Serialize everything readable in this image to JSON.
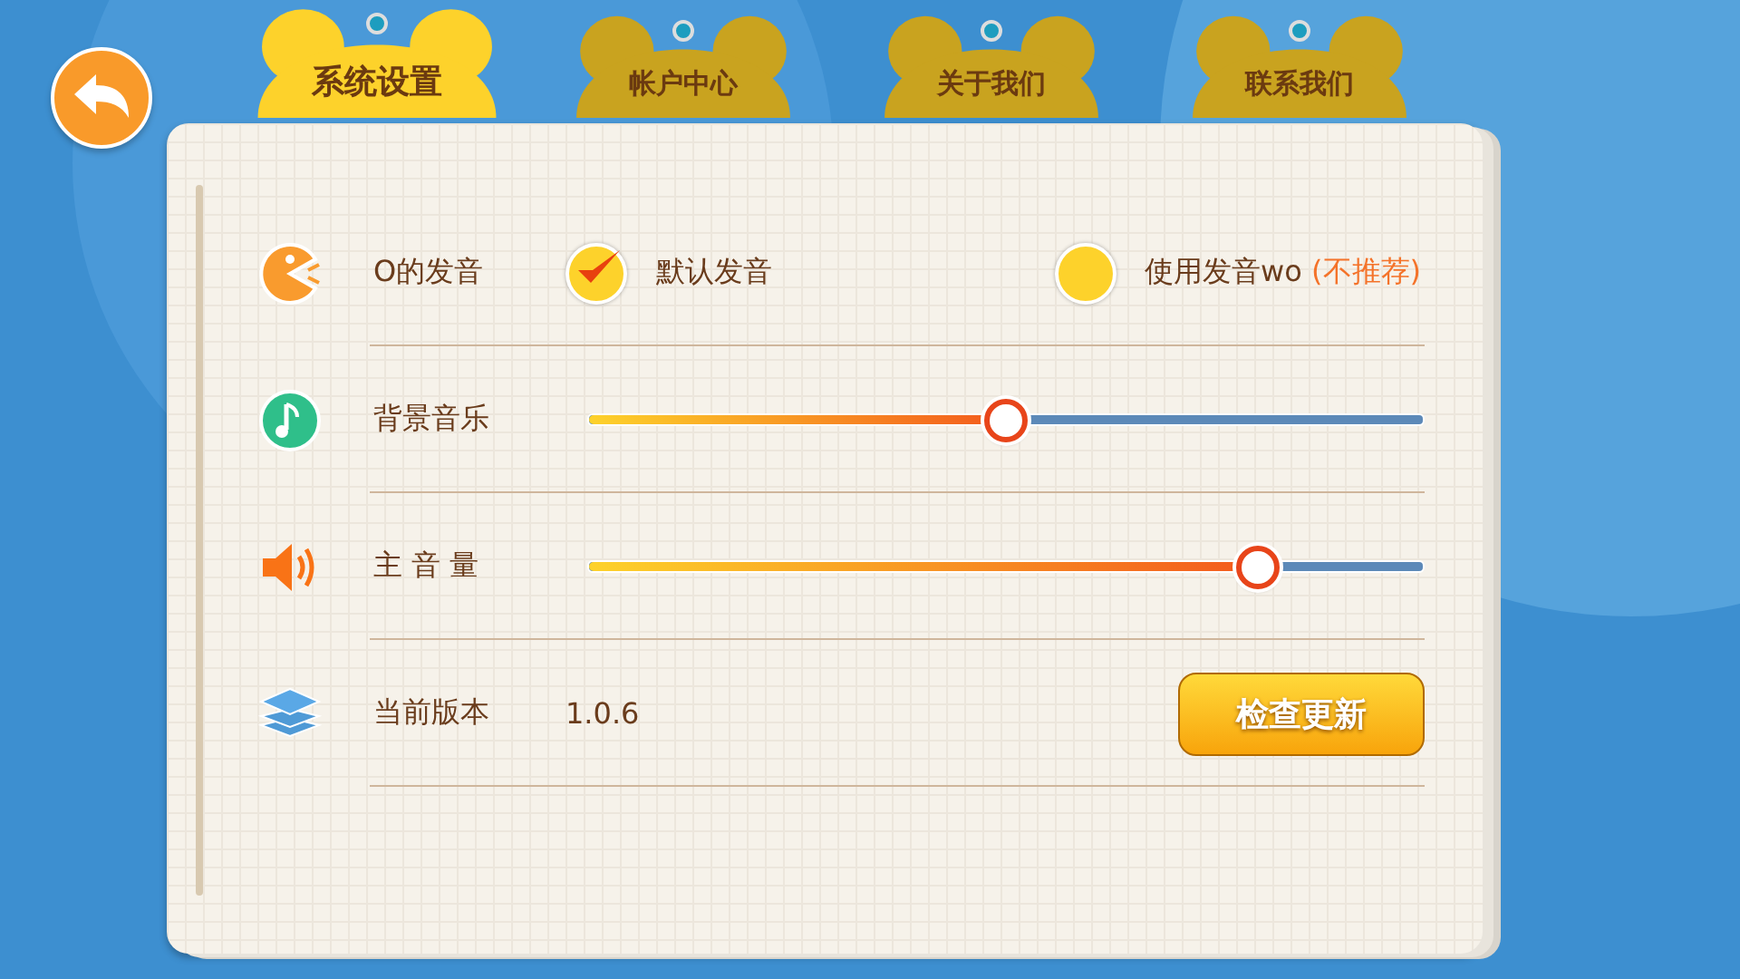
{
  "tabs": [
    {
      "label": "系统设置",
      "selected": true
    },
    {
      "label": "帐户中心",
      "selected": false
    },
    {
      "label": "关于我们",
      "selected": false
    },
    {
      "label": "联系我们",
      "selected": false
    }
  ],
  "rows": [
    {
      "kind": "radio",
      "label": "O的发音",
      "options": [
        {
          "label": "默认发音",
          "selected": true
        },
        {
          "label": "使用发音wo",
          "note": "(不推荐)",
          "selected": false
        }
      ]
    },
    {
      "kind": "slider",
      "label": "背景音乐",
      "level": 0.5
    },
    {
      "kind": "slider",
      "label": "主 音 量",
      "level": 0.8
    },
    {
      "kind": "version",
      "label": "当前版本",
      "value": "1.0.6",
      "button": "检查更新"
    }
  ]
}
